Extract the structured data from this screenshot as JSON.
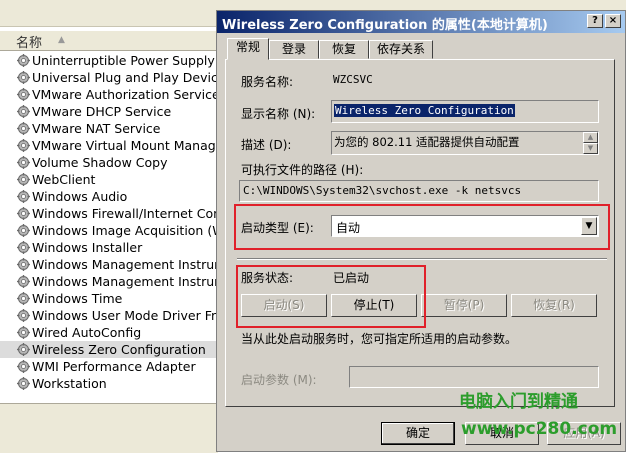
{
  "list": {
    "column_header": "名称",
    "items": [
      "Uninterruptible Power Supply",
      "Universal Plug and Play Device Host",
      "VMware Authorization Service",
      "VMware DHCP Service",
      "VMware NAT Service",
      "VMware Virtual Mount Manager",
      "Volume Shadow Copy",
      "WebClient",
      "Windows Audio",
      "Windows Firewall/Internet Connection",
      "Windows Image Acquisition (WIA)",
      "Windows Installer",
      "Windows Management Instrumentation",
      "Windows Management Instrumentation",
      "Windows Time",
      "Windows User Mode Driver Framework",
      "Wired AutoConfig",
      "Wireless Zero Configuration",
      "WMI Performance Adapter",
      "Workstation"
    ],
    "selected_index": 17
  },
  "dialog": {
    "title": "Wireless Zero Configuration 的属性(本地计算机)",
    "help_btn": "?",
    "close_btn": "×",
    "tabs": [
      "常规",
      "登录",
      "恢复",
      "依存关系"
    ],
    "active_tab": 0,
    "service_name_label": "服务名称:",
    "service_name_value": "WZCSVC",
    "display_name_label": "显示名称 (N):",
    "display_name_value": "Wireless Zero Configuration",
    "description_label": "描述 (D):",
    "description_value": "为您的 802.11 适配器提供自动配置",
    "exec_path_label": "可执行文件的路径 (H):",
    "exec_path_value": "C:\\WINDOWS\\System32\\svchost.exe -k netsvcs",
    "startup_type_label": "启动类型 (E):",
    "startup_type_value": "自动",
    "status_label": "服务状态:",
    "status_value": "已启动",
    "start_btn": "启动(S)",
    "stop_btn": "停止(T)",
    "pause_btn": "暂停(P)",
    "resume_btn": "恢复(R)",
    "hint_text": "当从此处启动服务时，您可指定所适用的启动参数。",
    "params_label": "启动参数 (M):",
    "params_value": "",
    "ok_btn": "确定",
    "cancel_btn": "取消",
    "apply_btn": "应用(A)"
  },
  "watermark": {
    "line1": "电脑入门到精通",
    "line2": "www.pc280.com"
  }
}
